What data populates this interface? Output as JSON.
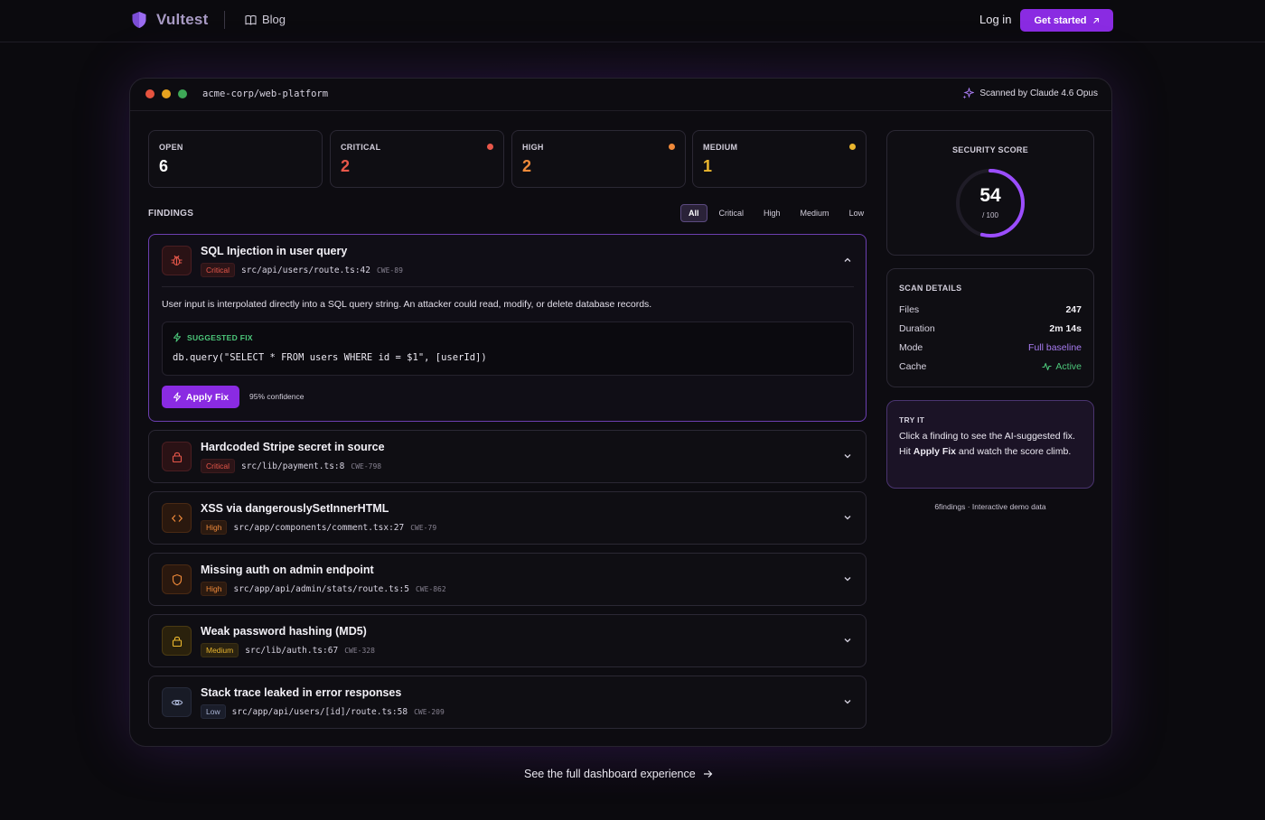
{
  "nav": {
    "brand": "Vultest",
    "blog": "Blog",
    "login": "Log in",
    "cta": "Get started"
  },
  "window": {
    "repo": "acme-corp/web-platform",
    "scanned_by": "Scanned by Claude 4.6 Opus"
  },
  "stats": [
    {
      "label": "OPEN",
      "value": "6",
      "color": "#ffffff"
    },
    {
      "label": "CRITICAL",
      "value": "2",
      "color": "#e8574a"
    },
    {
      "label": "HIGH",
      "value": "2",
      "color": "#f08a3a"
    },
    {
      "label": "MEDIUM",
      "value": "1",
      "color": "#eab62e"
    }
  ],
  "findings_header": {
    "title": "FINDINGS",
    "filters": [
      "All",
      "Critical",
      "High",
      "Medium",
      "Low"
    ],
    "active_filter": "All"
  },
  "findings": [
    {
      "title": "SQL Injection in user query",
      "severity": "Critical",
      "path": "src/api/users/route.ts:42",
      "cwe": "CWE-89",
      "icon": "bug-icon",
      "expanded": true,
      "description": "User input is interpolated directly into a SQL query string. An attacker could read, modify, or delete database records.",
      "fix_label": "SUGGESTED FIX",
      "fix_code": "db.query(\"SELECT * FROM users WHERE id = $1\", [userId])",
      "apply_label": "Apply Fix",
      "confidence": "95% confidence"
    },
    {
      "title": "Hardcoded Stripe secret in source",
      "severity": "Critical",
      "path": "src/lib/payment.ts:8",
      "cwe": "CWE-798",
      "icon": "lock-icon"
    },
    {
      "title": "XSS via dangerouslySetInnerHTML",
      "severity": "High",
      "path": "src/app/components/comment.tsx:27",
      "cwe": "CWE-79",
      "icon": "code-icon"
    },
    {
      "title": "Missing auth on admin endpoint",
      "severity": "High",
      "path": "src/app/api/admin/stats/route.ts:5",
      "cwe": "CWE-862",
      "icon": "shield-icon"
    },
    {
      "title": "Weak password hashing (MD5)",
      "severity": "Medium",
      "path": "src/lib/auth.ts:67",
      "cwe": "CWE-328",
      "icon": "lock-icon"
    },
    {
      "title": "Stack trace leaked in error responses",
      "severity": "Low",
      "path": "src/app/api/users/[id]/route.ts:58",
      "cwe": "CWE-209",
      "icon": "eye-icon"
    }
  ],
  "score": {
    "label": "SECURITY SCORE",
    "value": "54",
    "max": "/ 100",
    "fraction": 0.54
  },
  "scan_details": {
    "title": "SCAN DETAILS",
    "rows": [
      {
        "key": "Files",
        "value": "247"
      },
      {
        "key": "Duration",
        "value": "2m 14s"
      },
      {
        "key": "Mode",
        "value": "Full baseline"
      },
      {
        "key": "Cache",
        "value": "Active"
      }
    ]
  },
  "try_it": {
    "title": "TRY IT",
    "text_1": "Click a finding to see the AI-suggested fix. Hit ",
    "text_bold": "Apply Fix",
    "text_2": " and watch the score climb."
  },
  "footnote": "6findings · Interactive demo data",
  "see_full": "See the full dashboard experience",
  "colors": {
    "accent": "#8a2be2",
    "critical": "#e8574a",
    "high": "#f08a3a",
    "medium": "#eab62e",
    "low": "#a9b4d4",
    "success": "#4cc77a"
  }
}
